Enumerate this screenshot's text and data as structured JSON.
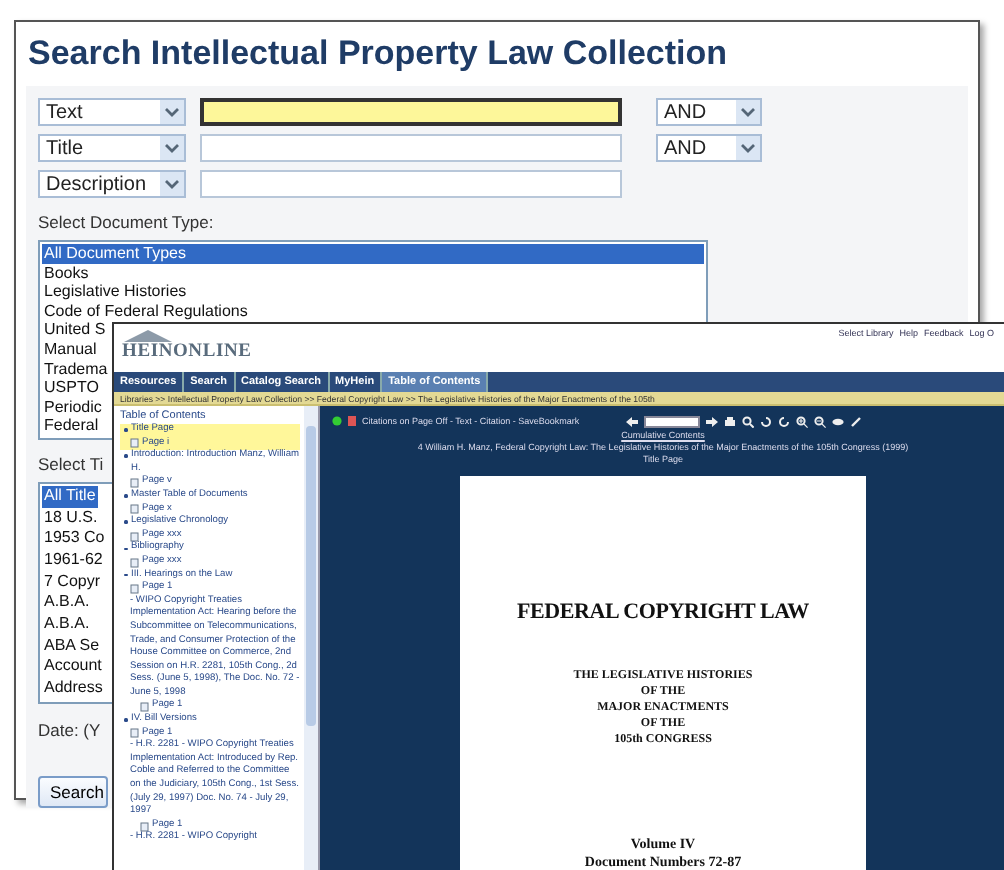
{
  "search_window": {
    "title": "Search Intellectual Property Law Collection",
    "query_rows": [
      {
        "field": "Text",
        "focused": true,
        "operator": "AND"
      },
      {
        "field": "Title",
        "focused": false,
        "operator": "AND"
      },
      {
        "field": "Description",
        "focused": false
      }
    ],
    "document_type_label": "Select Document Type:",
    "document_types": [
      {
        "label": "All Document Types",
        "selected": true
      },
      {
        "label": "Books",
        "selected": false
      },
      {
        "label": "Legislative Histories",
        "selected": false
      },
      {
        "label": "Code of Federal Regulations",
        "selected": false
      },
      {
        "label": "United S",
        "selected": false
      },
      {
        "label": "Manual",
        "selected": false
      },
      {
        "label": "Tradema",
        "selected": false
      },
      {
        "label": "USPTO",
        "selected": false
      },
      {
        "label": "Periodic",
        "selected": false
      },
      {
        "label": "Federal",
        "selected": false
      }
    ],
    "title_label": "Select Ti",
    "titles": [
      {
        "label": "All Title",
        "selected": true
      },
      {
        "label": "18 U.S.",
        "selected": false
      },
      {
        "label": "1953 Co",
        "selected": false
      },
      {
        "label": "1961-62",
        "selected": false
      },
      {
        "label": "7 Copyr",
        "selected": false
      },
      {
        "label": "A.B.A.",
        "selected": false
      },
      {
        "label": "A.B.A.",
        "selected": false
      },
      {
        "label": "ABA Se",
        "selected": false
      },
      {
        "label": "Account",
        "selected": false
      },
      {
        "label": "Address",
        "selected": false
      }
    ],
    "date_label": "Date: (Y",
    "search_button": "Search"
  },
  "viewer_window": {
    "logo": "HEINONLINE",
    "header_links": [
      "Select Library",
      "Help",
      "Feedback",
      "Log O"
    ],
    "tabs": [
      {
        "label": "Resources",
        "selected": false
      },
      {
        "label": "Search",
        "selected": false
      },
      {
        "label": "Catalog Search",
        "selected": false
      },
      {
        "label": "MyHein",
        "selected": false
      },
      {
        "label": "Table of Contents",
        "selected": true
      }
    ],
    "breadcrumb": "Libraries >> Intellectual Property Law Collection >> Federal Copyright Law >> The Legislative Histories of the Major Enactments of the 105th",
    "toc_title": "Table of Contents",
    "toc": [
      {
        "label": "Title Page",
        "selected": true,
        "children": [
          {
            "kind": "page",
            "label": "Page i"
          }
        ]
      },
      {
        "label": "Introduction: Introduction Manz, William H.",
        "selected": false,
        "children": [
          {
            "kind": "page",
            "label": "Page v"
          }
        ]
      },
      {
        "label": "Master Table of Documents",
        "selected": false,
        "children": [
          {
            "kind": "page",
            "label": "Page x"
          }
        ]
      },
      {
        "label": "Legislative Chronology",
        "selected": false,
        "children": [
          {
            "kind": "page",
            "label": "Page xxx"
          }
        ]
      },
      {
        "label": "Bibliography",
        "selected": false,
        "children": [
          {
            "kind": "page",
            "label": "Page xxx"
          }
        ]
      },
      {
        "label": "III. Hearings on the Law",
        "selected": false,
        "children": [
          {
            "kind": "page",
            "label": "Page 1"
          },
          {
            "kind": "entry",
            "label": "- WIPO Copyright Treaties Implementation Act: Hearing before the Subcommittee on Telecommunications, Trade, and Consumer Protection of the House Committee on Commerce, 2nd Session on H.R. 2281, 105th Cong., 2d Sess. (June 5, 1998), The Doc. No. 72 - June 5, 1998",
            "children": [
              {
                "kind": "page",
                "label": "Page 1"
              }
            ]
          }
        ]
      },
      {
        "label": "IV. Bill Versions",
        "selected": false,
        "children": [
          {
            "kind": "page",
            "label": "Page 1"
          },
          {
            "kind": "entry",
            "label": "- H.R. 2281 - WIPO Copyright Treaties Implementation Act: Introduced by Rep. Coble and Referred to the Committee on the Judiciary, 105th Cong., 1st Sess. (July 29, 1997) Doc. No. 74 - July 29, 1997",
            "children": [
              {
                "kind": "page",
                "label": "Page 1"
              }
            ]
          },
          {
            "kind": "entry",
            "label": "- H.R. 2281 - WIPO Copyright"
          }
        ]
      }
    ],
    "toolbar_text": "Citations on Page Off - Text - Citation - SaveBookmark",
    "cumulative_contents": "Cumulative Contents",
    "citation": "4 William H. Manz, Federal Copyright Law: The Legislative Histories of the Major Enactments of the 105th Congress (1999)",
    "section": "Title Page",
    "page": {
      "title": "FEDERAL COPYRIGHT LAW",
      "subtitle_lines": [
        "THE LEGISLATIVE HISTORIES",
        "OF THE",
        "MAJOR ENACTMENTS",
        "OF THE",
        "105th CONGRESS"
      ],
      "volume": "Volume IV",
      "documents": "Document Numbers 72-87"
    }
  }
}
